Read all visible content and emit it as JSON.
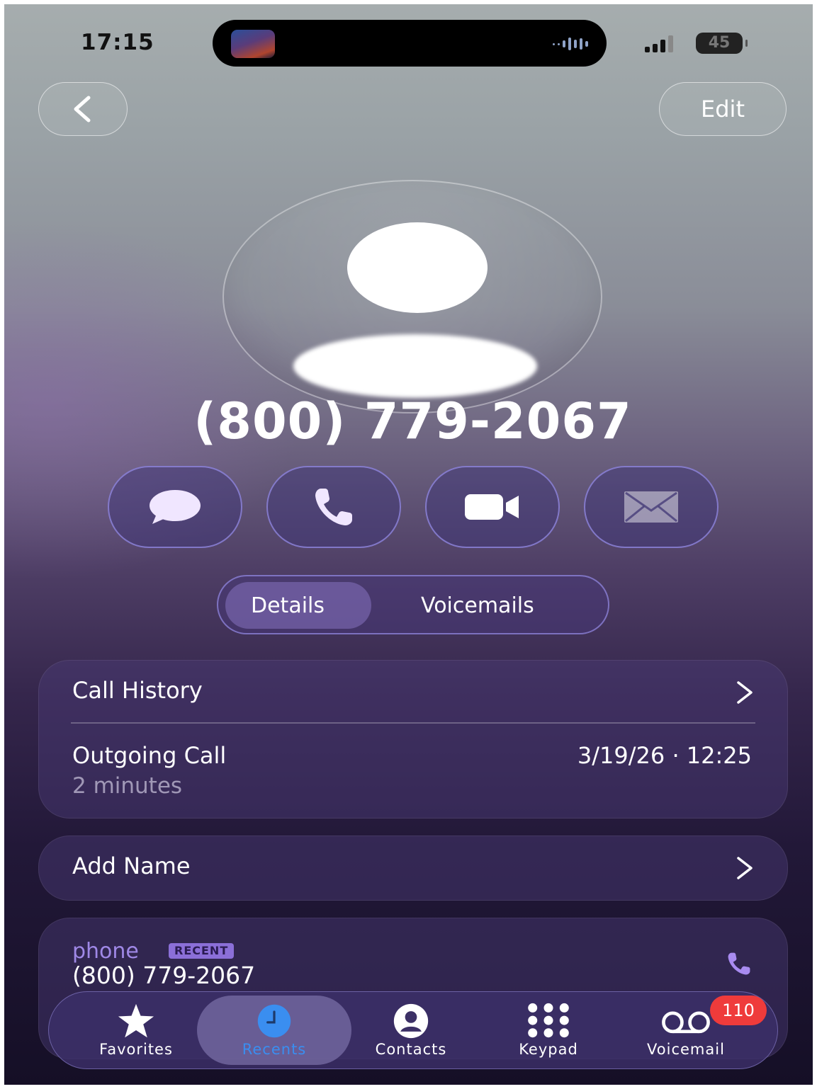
{
  "status_bar": {
    "time": "17:15",
    "battery": "45"
  },
  "header": {
    "edit_label": "Edit"
  },
  "contact": {
    "number": "(800) 779-2067"
  },
  "actions": [
    {
      "icon": "message-icon"
    },
    {
      "icon": "phone-icon"
    },
    {
      "icon": "video-icon"
    },
    {
      "icon": "mail-icon"
    }
  ],
  "segments": {
    "details": "Details",
    "voicemails": "Voicemails",
    "selected": "Details"
  },
  "call_history": {
    "title": "Call History",
    "entry": {
      "type": "Outgoing Call",
      "duration": "2 minutes",
      "timestamp": "3/19/26 · 12:25"
    }
  },
  "add_name": {
    "label": "Add Name"
  },
  "phone_row": {
    "label": "phone",
    "badge": "RECENT",
    "value": "(800) 779-2067"
  },
  "tabbar": {
    "tabs": [
      {
        "label": "Favorites",
        "icon": "star-icon"
      },
      {
        "label": "Recents",
        "icon": "clock-icon"
      },
      {
        "label": "Contacts",
        "icon": "person-icon"
      },
      {
        "label": "Keypad",
        "icon": "keypad-icon"
      },
      {
        "label": "Voicemail",
        "icon": "voicemail-icon"
      }
    ],
    "selected": "Recents",
    "voicemail_badge": "110"
  },
  "colors": {
    "accent": "#3a8ef0",
    "badge_red": "#ef3b3b",
    "phone_label": "#9f88e6"
  }
}
